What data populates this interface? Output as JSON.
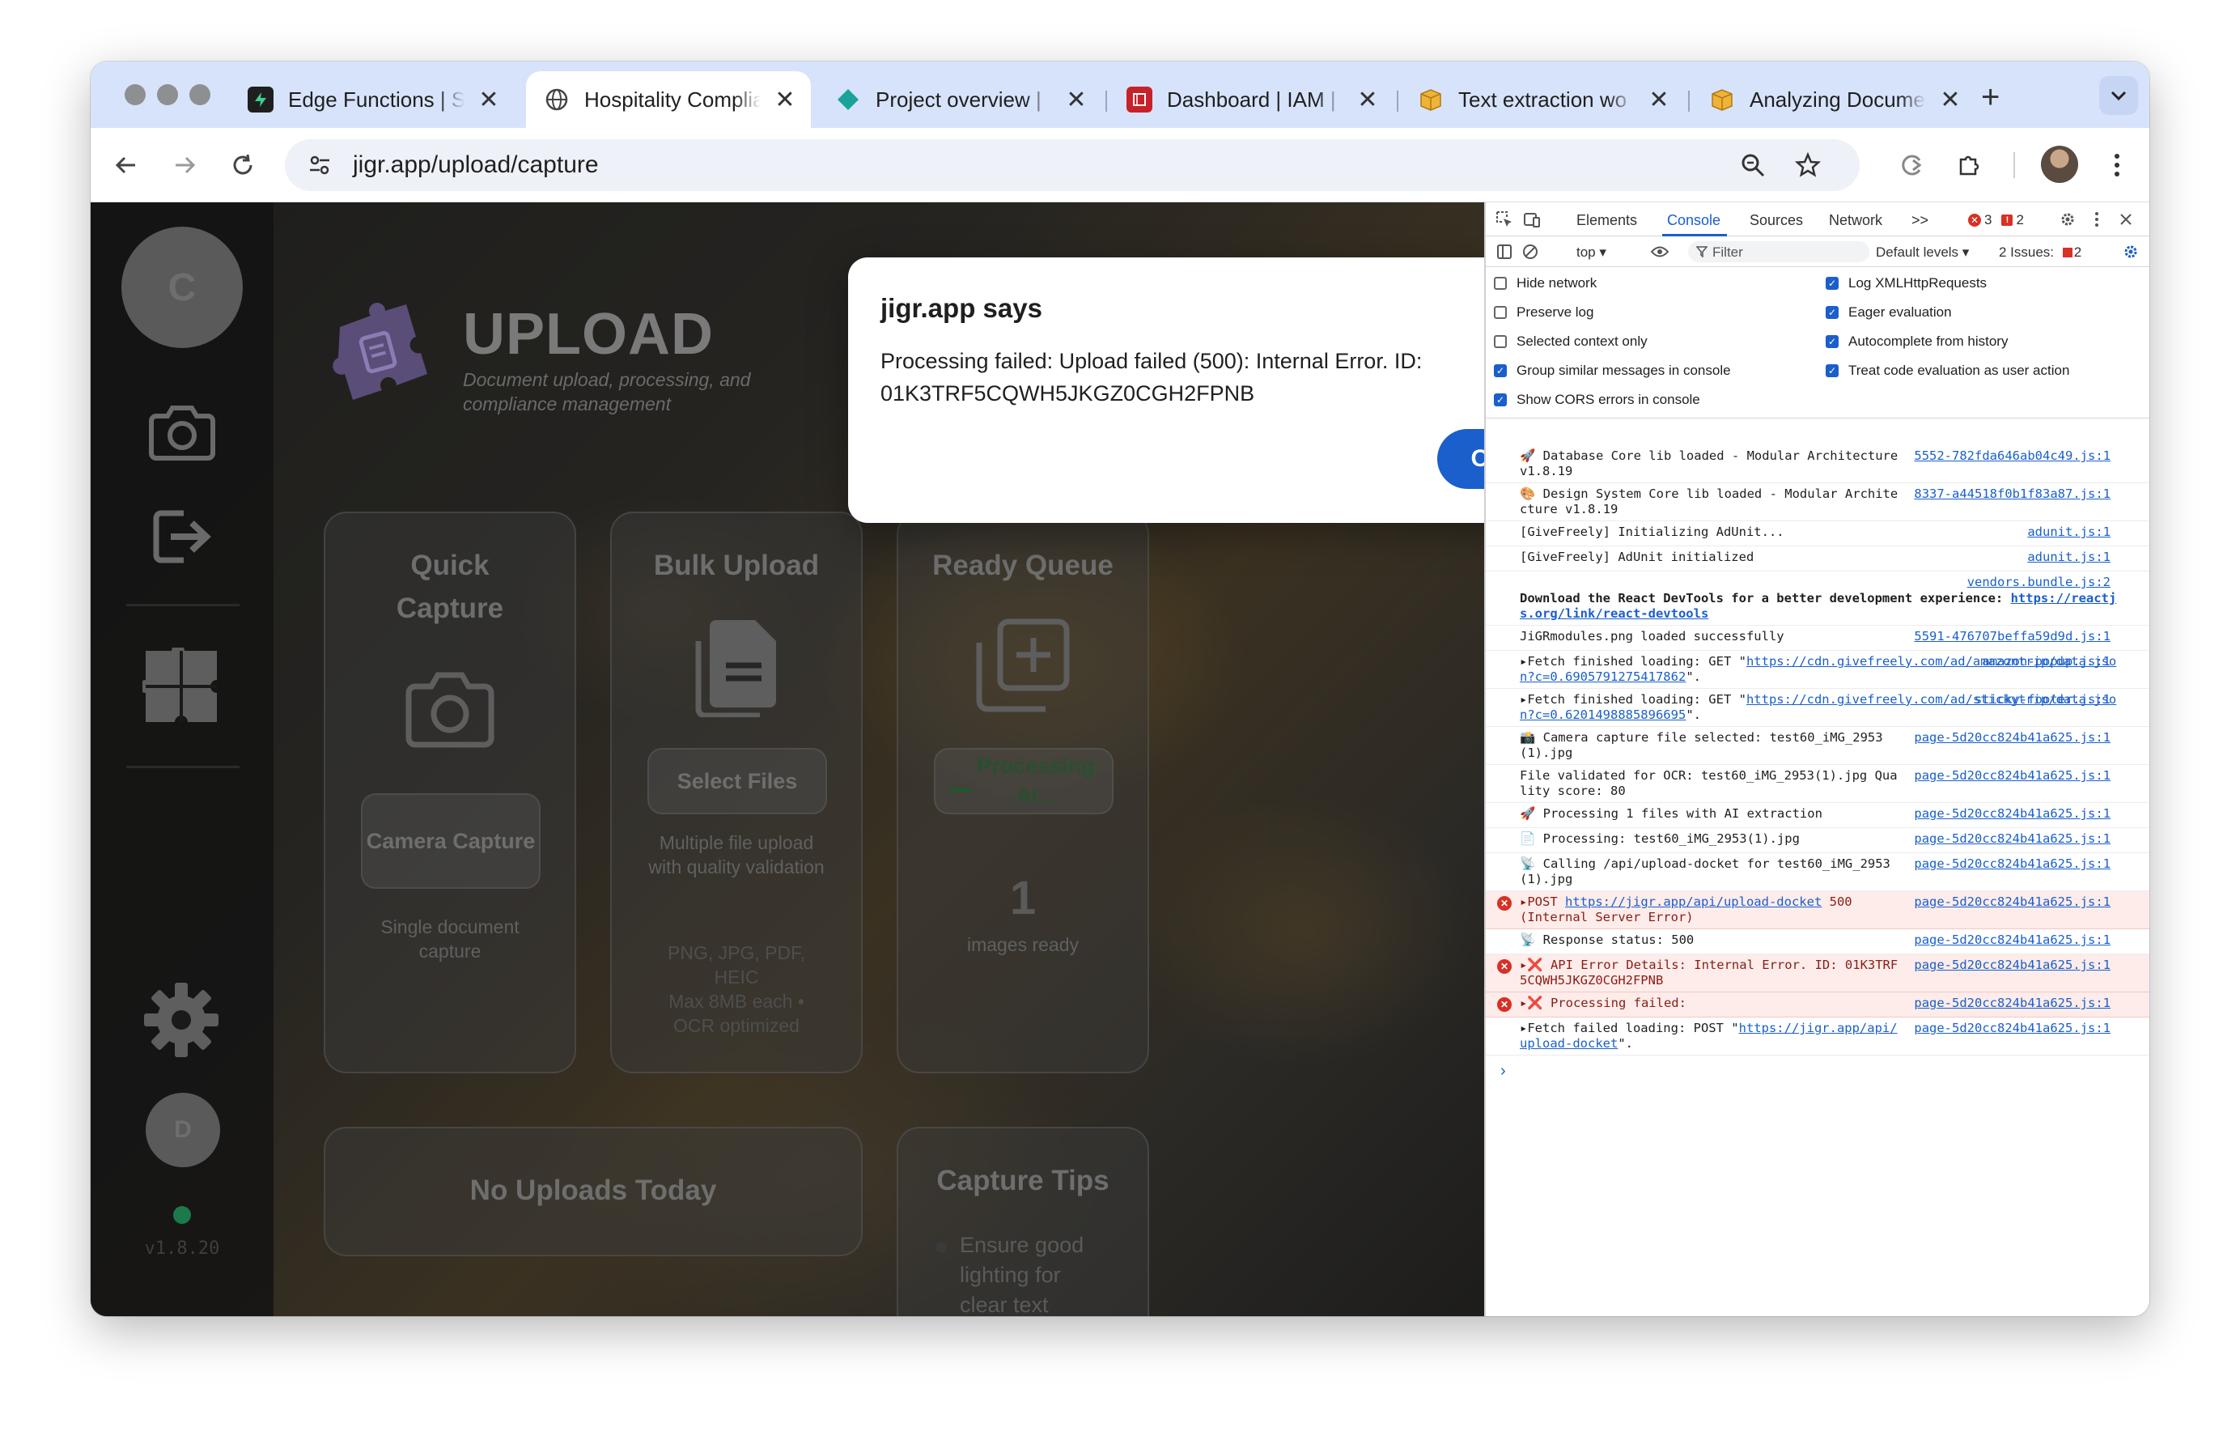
{
  "browser": {
    "tabs": [
      {
        "label": "Edge Functions | S",
        "icon": "supabase-icon",
        "active": false
      },
      {
        "label": "Hospitality Complia",
        "icon": "globe-icon",
        "active": true
      },
      {
        "label": "Project overview | ",
        "icon": "diamond-icon",
        "active": false
      },
      {
        "label": "Dashboard | IAM | ",
        "icon": "aws-icon",
        "active": false
      },
      {
        "label": "Text extraction wo",
        "icon": "box-icon",
        "active": false
      },
      {
        "label": "Analyzing Docume",
        "icon": "box-icon",
        "active": false
      }
    ],
    "close_glyph": "✕",
    "new_tab_glyph": "+",
    "url": "jigr.app/upload/capture"
  },
  "app": {
    "sidebar": {
      "user_initial": "C",
      "bottom_initial": "D",
      "version": "v1.8.20"
    },
    "header": {
      "title": "UPLOAD",
      "subtitle": "Document upload, processing, and compliance management"
    },
    "cards": {
      "quick": {
        "title": "Quick Capture",
        "button": "Camera Capture",
        "desc": "Single document capture"
      },
      "bulk": {
        "title": "Bulk Upload",
        "button": "Select Files",
        "desc": "Multiple file upload with quality validation",
        "formats": "PNG, JPG, PDF, HEIC",
        "limits": "Max 8MB each • OCR optimized"
      },
      "queue": {
        "title": "Ready Queue",
        "button": "Processing AI...",
        "count": "1",
        "desc": "images ready"
      },
      "no_uploads": {
        "title": "No Uploads Today"
      },
      "tips": {
        "title": "Capture Tips",
        "tip1": "Ensure good lighting for clear text"
      }
    }
  },
  "dialog": {
    "title": "jigr.app says",
    "message": "Processing failed: Upload failed (500): Internal Error. ID: 01K3TRF5CQWH5JKGZ0CGH2FPNB",
    "ok": "OK"
  },
  "devtools": {
    "tabs": [
      "Elements",
      "Console",
      "Sources",
      "Network"
    ],
    "active_tab": "Console",
    "more": ">>",
    "error_count": "3",
    "issue_count": "2",
    "context": "top ▾",
    "filter_placeholder": "Filter",
    "levels": "Default levels ▾",
    "issues_label": "2 Issues:",
    "issues_count": "2",
    "settings": [
      {
        "label": "Hide network",
        "checked": false
      },
      {
        "label": "Log XMLHttpRequests",
        "checked": true
      },
      {
        "label": "Preserve log",
        "checked": false
      },
      {
        "label": "Eager evaluation",
        "checked": true
      },
      {
        "label": "Selected context only",
        "checked": false
      },
      {
        "label": "Autocomplete from history",
        "checked": true
      },
      {
        "label": "Group similar messages in console",
        "checked": true
      },
      {
        "label": "Treat code evaluation as user action",
        "checked": true
      },
      {
        "label": "Show CORS errors in console",
        "checked": true
      }
    ],
    "logs": [
      {
        "text": "🚀 Database Core lib loaded - Modular Architecture v1.8.19",
        "src": "5552-782fda646ab04c49.js:1",
        "type": "info"
      },
      {
        "text": "🎨 Design System Core lib loaded - Modular Architecture v1.8.19",
        "src": "8337-a44518f0b1f83a87.js:1",
        "type": "info"
      },
      {
        "text": "[GiveFreely] Initializing AdUnit...",
        "src": "adunit.js:1",
        "type": "info"
      },
      {
        "text": "[GiveFreely] AdUnit initialized",
        "src": "adunit.js:1",
        "type": "info"
      },
      {
        "text": "Download the React DevTools for a better development experience: ",
        "link": "https://reactjs.org/link/react-devtools",
        "src": "vendors.bundle.js:2",
        "type": "bold"
      },
      {
        "text": "JiGRmodules.png loaded successfully",
        "src": "5591-476707beffa59d9d.js:1",
        "type": "info"
      },
      {
        "text": "▸Fetch finished loading: GET \"",
        "link": "https://cdn.givefreely.com/ad/amazontrip/data.json?c=0.6905791275417862",
        "tail": "\".",
        "src": "amazon-popup.js:1",
        "type": "fetch"
      },
      {
        "text": "▸Fetch finished loading: GET \"",
        "link": "https://cdn.givefreely.com/ad/stickytrip/data.json?c=0.6201498885896695",
        "tail": "\".",
        "src": "sticky-footer.js:1",
        "type": "fetch"
      },
      {
        "text": "📸 Camera capture file selected: test60_iMG_2953(1).jpg",
        "src": "page-5d20cc824b41a625.js:1",
        "type": "info"
      },
      {
        "text": "File validated for OCR: test60_iMG_2953(1).jpg Quality score: 80",
        "src": "page-5d20cc824b41a625.js:1",
        "type": "info"
      },
      {
        "text": "🚀 Processing 1 files with AI extraction",
        "src": "page-5d20cc824b41a625.js:1",
        "type": "info"
      },
      {
        "text": "📄 Processing: test60_iMG_2953(1).jpg",
        "src": "page-5d20cc824b41a625.js:1",
        "type": "info"
      },
      {
        "text": "📡 Calling /api/upload-docket for test60_iMG_2953(1).jpg",
        "src": "page-5d20cc824b41a625.js:1",
        "type": "info"
      },
      {
        "text": "▸POST ",
        "link": "https://jigr.app/api/upload-docket",
        "tail": " 500 (Internal Server Error)",
        "src": "page-5d20cc824b41a625.js:1",
        "type": "error"
      },
      {
        "text": "📡 Response status: 500",
        "src": "page-5d20cc824b41a625.js:1",
        "type": "info"
      },
      {
        "text": "▸❌ API Error Details: Internal Error. ID: 01K3TRF5CQWH5JKGZ0CGH2FPNB",
        "src": "page-5d20cc824b41a625.js:1",
        "type": "error"
      },
      {
        "text": "▸❌ Processing failed:",
        "src": "page-5d20cc824b41a625.js:1",
        "type": "error"
      },
      {
        "text": "▸Fetch failed loading: POST \"",
        "link": "https://jigr.app/api/upload-docket",
        "tail": "\".",
        "src": "page-5d20cc824b41a625.js:1",
        "type": "fetch"
      }
    ],
    "prompt": "›"
  },
  "colors": {
    "accent": "#1a5fcb",
    "error": "#d93025",
    "error_bg": "#fdecea",
    "tab_strip": "#d7e3fb"
  }
}
